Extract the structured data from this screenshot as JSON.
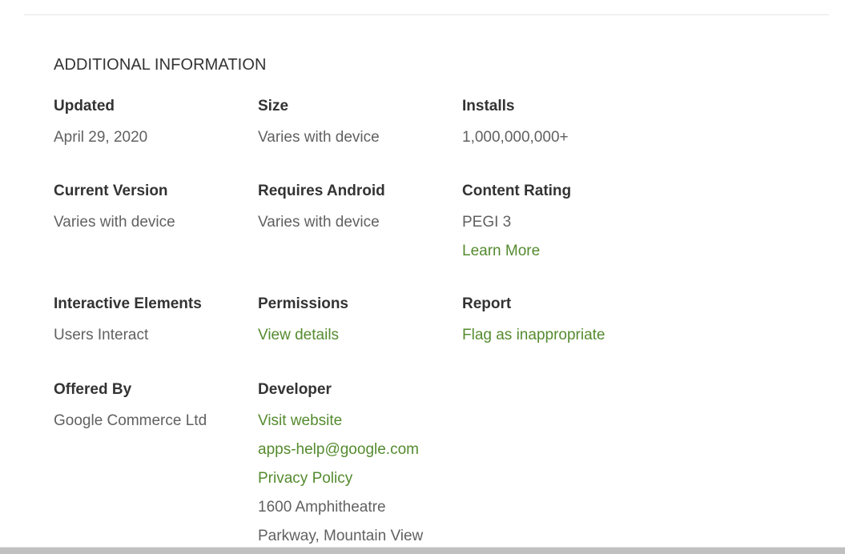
{
  "section_title": "ADDITIONAL INFORMATION",
  "fields": {
    "updated": {
      "label": "Updated",
      "value": "April 29, 2020"
    },
    "size": {
      "label": "Size",
      "value": "Varies with device"
    },
    "installs": {
      "label": "Installs",
      "value": "1,000,000,000+"
    },
    "current_version": {
      "label": "Current Version",
      "value": "Varies with device"
    },
    "requires_android": {
      "label": "Requires Android",
      "value": "Varies with device"
    },
    "content_rating": {
      "label": "Content Rating",
      "value": "PEGI 3",
      "link": "Learn More"
    },
    "interactive_elements": {
      "label": "Interactive Elements",
      "value": "Users Interact"
    },
    "permissions": {
      "label": "Permissions",
      "link": "View details"
    },
    "report": {
      "label": "Report",
      "link": "Flag as inappropriate"
    },
    "offered_by": {
      "label": "Offered By",
      "value": "Google Commerce Ltd"
    },
    "developer": {
      "label": "Developer",
      "website_link": "Visit website",
      "email_link": "apps-help@google.com",
      "privacy_link": "Privacy Policy",
      "address_line1": "1600 Amphitheatre",
      "address_line2": "Parkway, Mountain View"
    }
  },
  "colors": {
    "link": "#558b2f",
    "text": "#616161",
    "heading": "#333333"
  }
}
